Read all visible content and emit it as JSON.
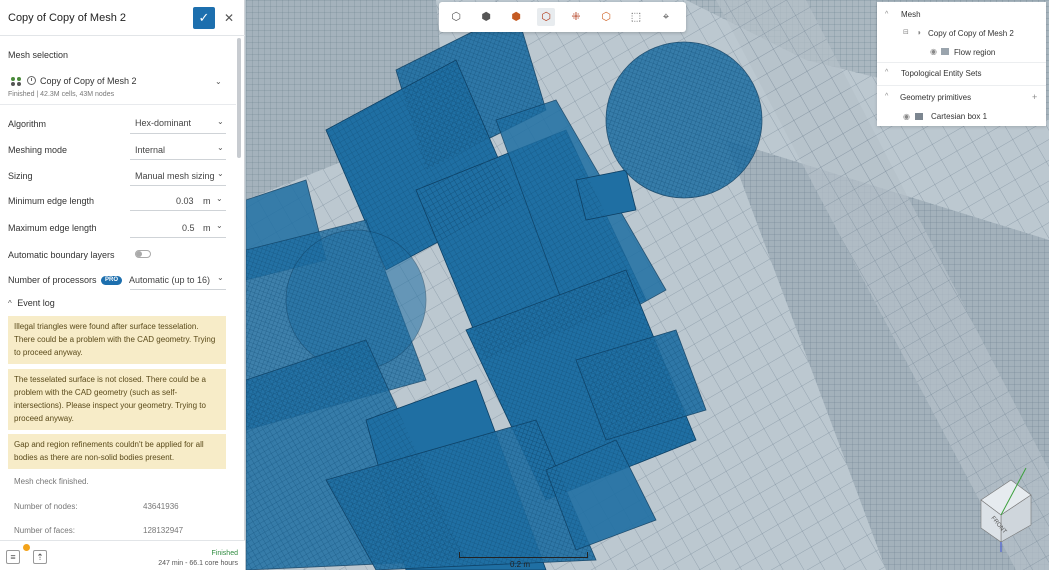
{
  "panel": {
    "title": "Copy of Copy of Mesh 2",
    "confirm_icon": "check-icon",
    "close_icon": "close-icon",
    "confirm_glyph": "✓",
    "close_glyph": "✕"
  },
  "mesh_selection": {
    "label": "Mesh selection",
    "name": "Copy of Copy of Mesh 2",
    "status": "Finished | 42.3M cells, 43M nodes"
  },
  "settings": {
    "algorithm_label": "Algorithm",
    "algorithm_value": "Hex-dominant",
    "meshing_mode_label": "Meshing mode",
    "meshing_mode_value": "Internal",
    "sizing_label": "Sizing",
    "sizing_value": "Manual mesh sizing",
    "min_edge_label": "Minimum edge length",
    "min_edge_value": "0.03",
    "max_edge_label": "Maximum edge length",
    "max_edge_value": "0.5",
    "unit": "m",
    "boundary_layers_label": "Automatic boundary layers",
    "boundary_layers_enabled": false,
    "processors_label": "Number of processors",
    "pro_badge": "PRO",
    "processors_value": "Automatic (up to 16)"
  },
  "event_log": {
    "title": "Event log",
    "warnings": [
      "Illegal triangles were found after surface tesselation. There could be a problem with the CAD geometry. Trying to proceed anyway.",
      "The tesselated surface is not closed. There could be a problem with the CAD geometry (such as self-intersections). Please inspect your geometry. Trying to proceed anyway.",
      "Gap and region refinements couldn't be applied for all bodies as there are non-solid bodies present."
    ],
    "message": "Mesh check finished.",
    "stats": [
      {
        "label": "Number of nodes:",
        "value": "43641936"
      },
      {
        "label": "Number of faces:",
        "value": "128132947"
      }
    ]
  },
  "footer": {
    "status": "Finished",
    "time": "247 min - 66.1 core hours"
  },
  "tree": {
    "mesh_label": "Mesh",
    "mesh_item": "Copy of Copy of Mesh 2",
    "flow_region": "Flow region",
    "topo_label": "Topological Entity Sets",
    "geo_label": "Geometry primitives",
    "box_item": "Cartesian box 1",
    "plus": "+"
  },
  "viewport": {
    "scale_label": "0.2 m",
    "cube_label": "FRONT",
    "mesh_color": "#1f6fa3",
    "background_color": "#bcc8d0"
  },
  "toolbar": {
    "buttons": [
      "cube-outline-icon",
      "cube-solid-icon",
      "cube-red-icon",
      "cube-wire-red-icon",
      "cube-dots-icon",
      "cube-orange-icon",
      "box-select-icon",
      "section-icon"
    ]
  },
  "colors": {
    "accent": "#1d6fae",
    "warning_bg": "#f7ecc8",
    "success": "#2e8b3e",
    "notification": "#f3a31a"
  }
}
